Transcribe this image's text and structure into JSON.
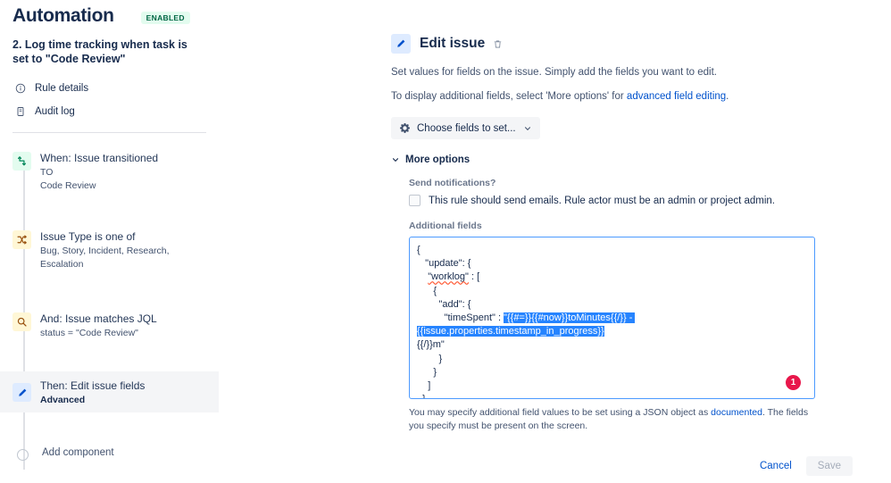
{
  "sidebar": {
    "app_title": "Automation",
    "status_badge": "ENABLED",
    "rule_name": "2. Log time tracking when task is set to \"Code Review\"",
    "nav": [
      {
        "label": "Rule details",
        "icon": "info-circle-icon"
      },
      {
        "label": "Audit log",
        "icon": "document-icon"
      }
    ],
    "components": [
      {
        "title": "When: Issue transitioned",
        "sub1": "TO",
        "sub2": "Code Review",
        "icon": "transition-icon",
        "tone": "green",
        "selected": false
      },
      {
        "title": "Issue Type is one of",
        "sub1": "Bug, Story, Incident, Research,",
        "sub2": "Escalation",
        "icon": "shuffle-icon",
        "tone": "yellow",
        "selected": false
      },
      {
        "title": "And: Issue matches JQL",
        "sub1": "status = \"Code Review\"",
        "sub2": "",
        "icon": "search-icon",
        "tone": "yellow",
        "selected": false
      },
      {
        "title": "Then: Edit issue fields",
        "sub1": "Advanced",
        "sub2": "",
        "icon": "pencil-icon",
        "tone": "blue",
        "selected": true
      }
    ],
    "add_component_label": "Add component"
  },
  "panel": {
    "title": "Edit issue",
    "icon": "pencil-icon",
    "delete_icon": "trash-icon",
    "description_1": "Set values for fields on the issue. Simply add the fields you want to edit.",
    "description_2_prefix": "To display additional fields, select 'More options' for ",
    "description_2_link": "advanced field editing",
    "description_2_suffix": ".",
    "choose_fields_label": "Choose fields to set...",
    "more_options_label": "More options",
    "send_notifications_label": "Send notifications?",
    "send_emails_checkbox_label": "This rule should send emails. Rule actor must be an admin or project admin.",
    "send_emails_checked": false,
    "additional_fields_label": "Additional fields",
    "annotation_badge": "1",
    "help_text_prefix": "You may specify additional field values to be set using a JSON object as ",
    "help_text_link": "documented",
    "help_text_suffix": ". The fields you specify must be present on the screen.",
    "cancel_label": "Cancel",
    "save_label": "Save"
  },
  "code": {
    "line_1": "{",
    "line_2": "   \"update\": {",
    "line_3_pre": "    ",
    "line_3_word": "\"worklog\"",
    "line_3_post": " : [",
    "line_4": "      {",
    "line_5": "        \"add\": {",
    "line_6_pre": "          \"timeSpent\" : ",
    "line_6_selected": "\"{{#=}}{{#now}}toMinutes{{/}} - {{issue.properties.timestamp_in_progress}}",
    "line_7": "{{/}}m\"",
    "line_8": "        }",
    "line_9": "      }",
    "line_10": "    ]",
    "line_11": "  }",
    "line_12": "}"
  }
}
